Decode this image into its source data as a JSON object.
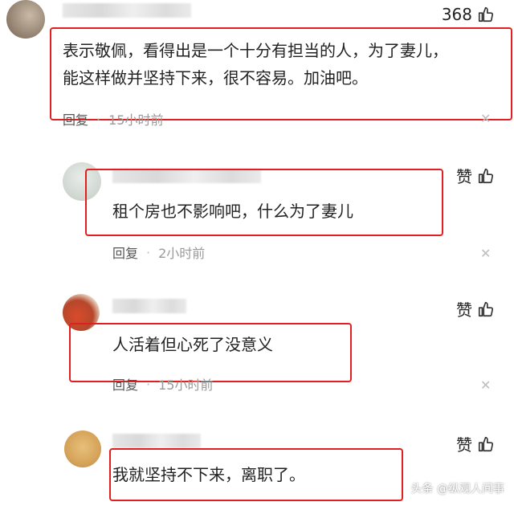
{
  "comments": [
    {
      "text": "表示敬佩，看得出是一个十分有担当的人，为了妻儿，能这样做并坚持下来，很不容易。加油吧。",
      "line1": "表示敬佩，看得出是一个十分有担当的人，为了妻儿，",
      "line2": "能这样做并坚持下来，很不容易。加油吧。",
      "reply_label": "回复",
      "time": "15小时前",
      "likes": "368"
    },
    {
      "text": "租个房也不影响吧，什么为了妻儿",
      "reply_label": "回复",
      "time": "2小时前",
      "likes": "赞"
    },
    {
      "text": "人活着但心死了没意义",
      "reply_label": "回复",
      "time": "15小时前",
      "likes": "赞"
    },
    {
      "text": "我就坚持不下来，离职了。",
      "likes": "赞"
    }
  ],
  "separator": "·",
  "close_glyph": "✕",
  "watermark": "头条 @纵观人间事",
  "colors": {
    "highlight_box": "#e02020",
    "muted": "#9a9a9a"
  },
  "icons": [
    "thumbs-up-icon",
    "close-icon"
  ]
}
